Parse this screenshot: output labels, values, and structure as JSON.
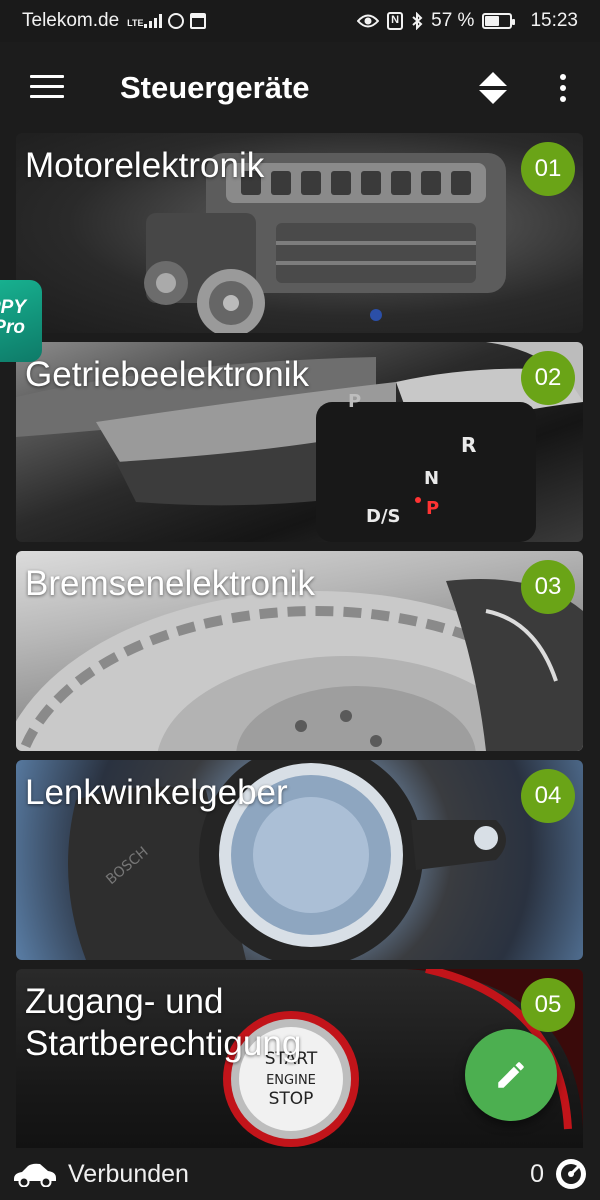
{
  "status_bar": {
    "carrier": "Telekom.de",
    "network_type": "LTE",
    "battery_percent": "57 %",
    "battery_level": 0.57,
    "time": "15:23"
  },
  "app_bar": {
    "title": "Steuergeräte",
    "icons": [
      "menu-icon",
      "sort-icon",
      "more-vert-icon"
    ]
  },
  "control_units": [
    {
      "title": "Motorelektronik",
      "number": "01"
    },
    {
      "title": "Getriebeelektronik",
      "number": "02"
    },
    {
      "title": "Bremsenelektronik",
      "number": "03"
    },
    {
      "title": "Lenkwinkelgeber",
      "number": "04"
    },
    {
      "title": "Zugang- und Startberechtigung",
      "number": "05"
    }
  ],
  "images": {
    "card_2_text": [
      "P",
      "R",
      "N",
      "D/S"
    ],
    "card_4_brand": "BOSCH",
    "card_5_button_lines": [
      "START",
      "ENGINE",
      "STOP"
    ]
  },
  "side_bubble": {
    "text": "PPY\nIPro"
  },
  "fab": {
    "icon": "edit-icon",
    "color": "#4caf50"
  },
  "bottom_bar": {
    "connection_status": "Verbunden",
    "count": "0"
  },
  "colors": {
    "badge": "#6aa417",
    "background": "#1c1c1c"
  }
}
